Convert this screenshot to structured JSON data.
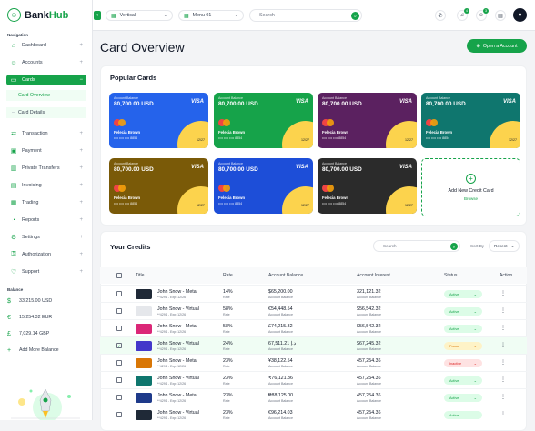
{
  "brand": {
    "name_a": "Bank",
    "name_b": "Hub"
  },
  "sidebar": {
    "navigation_label": "Navigation",
    "items": [
      {
        "label": "Dashboard",
        "icon": "home-icon"
      },
      {
        "label": "Accounts",
        "icon": "users-icon"
      },
      {
        "label": "Cards",
        "icon": "card-icon",
        "active": true
      },
      {
        "label": "Transaction",
        "icon": "transfer-icon"
      },
      {
        "label": "Payment",
        "icon": "wallet-icon"
      },
      {
        "label": "Private Transfers",
        "icon": "bars-icon"
      },
      {
        "label": "Invoicing",
        "icon": "document-icon"
      },
      {
        "label": "Trading",
        "icon": "chart-icon"
      },
      {
        "label": "Reports",
        "icon": "pie-icon"
      },
      {
        "label": "Settings",
        "icon": "gear-icon"
      },
      {
        "label": "Authorization",
        "icon": "key-icon"
      },
      {
        "label": "Support",
        "icon": "support-icon"
      }
    ],
    "sub_items": [
      {
        "label": "Card Overview",
        "active": true
      },
      {
        "label": "Card Details"
      }
    ],
    "balance_label": "Balance",
    "balances": [
      {
        "symbol": "$",
        "value": "33,215.00 USD"
      },
      {
        "symbol": "€",
        "value": "15,254.32 EUR"
      },
      {
        "symbol": "£",
        "value": "7,029.14 GBP"
      },
      {
        "symbol": "+",
        "value": "Add More Balance"
      }
    ]
  },
  "topbar": {
    "layout_select": "Vertical",
    "menu_select": "Menu 01",
    "search_placeholder": "Search",
    "notif_count": "4",
    "msg_count": "3"
  },
  "page": {
    "title": "Card Overview",
    "open_account": "Open a Account"
  },
  "popular": {
    "title": "Popular Cards",
    "more": "...",
    "cards": [
      {
        "label": "Account Balance",
        "balance": "80,700.00 USD",
        "brand": "VISA",
        "holder": "Felecia Brown",
        "number": "•••• •••• •••• 8854",
        "expiry": "12/27",
        "bg": "#2563eb"
      },
      {
        "label": "Account Balance",
        "balance": "80,700.00 USD",
        "brand": "VISA",
        "holder": "Felecia Brown",
        "number": "•••• •••• •••• 8854",
        "expiry": "12/27",
        "bg": "#16a34a"
      },
      {
        "label": "Account Balance",
        "balance": "80,700.00 USD",
        "brand": "VISA",
        "holder": "Felecia Brown",
        "number": "•••• •••• •••• 8854",
        "expiry": "12/27",
        "bg": "#5b2160"
      },
      {
        "label": "Account Balance",
        "balance": "80,700.00 USD",
        "brand": "VISA",
        "holder": "Felecia Brown",
        "number": "•••• •••• •••• 8854",
        "expiry": "12/27",
        "bg": "#0f766e"
      },
      {
        "label": "Account Balance",
        "balance": "80,700.00 USD",
        "brand": "VISA",
        "holder": "Felecia Brown",
        "number": "•••• •••• •••• 8854",
        "expiry": "12/27",
        "bg": "#7a5a08"
      },
      {
        "label": "Account Balance",
        "balance": "80,700.00 USD",
        "brand": "VISA",
        "holder": "Felecia Brown",
        "number": "•••• •••• •••• 8854",
        "expiry": "12/27",
        "bg": "#1d4ed8"
      },
      {
        "label": "Account Balance",
        "balance": "80,700.00 USD",
        "brand": "VISA",
        "holder": "Felecia Brown",
        "number": "•••• •••• •••• 8854",
        "expiry": "12/27",
        "bg": "#2b2b2b"
      }
    ],
    "add_card": {
      "title": "Add New Credit Card",
      "browse": "Browse"
    }
  },
  "credits": {
    "title": "Your Credits",
    "search_placeholder": "Search",
    "sort_label": "Sort By",
    "sort_value": "Recent",
    "columns": [
      "Title",
      "Rate",
      "Account Balance",
      "Account Interest",
      "Status",
      "Action"
    ],
    "rows": [
      {
        "name": "John Snow - Metal",
        "sub": "**4291 - Exp: 12/26",
        "rate": "14%",
        "rate_sub": "Rate",
        "balance": "$65,200.00",
        "balance_sub": "Account Balance",
        "interest": "321,121.32",
        "interest_sub": "Account Balance",
        "status": "Active",
        "thumb": "#1f2937",
        "checked": false
      },
      {
        "name": "John Snow - Virtual",
        "sub": "**4291 - Exp: 12/26",
        "rate": "58%",
        "rate_sub": "Rate",
        "balance": "€54,448.54",
        "balance_sub": "Account Balance",
        "interest": "$56,542.32",
        "interest_sub": "Account Balance",
        "status": "Active",
        "thumb": "#e5e7eb",
        "checked": false
      },
      {
        "name": "John Snow - Metal",
        "sub": "**4291 - Exp: 12/26",
        "rate": "58%",
        "rate_sub": "Rate",
        "balance": "£74,215.32",
        "balance_sub": "Account Balance",
        "interest": "$56,542.32",
        "interest_sub": "Account Balance",
        "status": "Active",
        "thumb": "#db2777",
        "checked": false
      },
      {
        "name": "John Snow - Virtual",
        "sub": "**4291 - Exp: 12/26",
        "rate": "24%",
        "rate_sub": "Rate",
        "balance": "67,511.21 د.إ",
        "balance_sub": "Account Balance",
        "interest": "$67,245.32",
        "interest_sub": "Account Balance",
        "status": "Pause",
        "thumb": "#4338ca",
        "checked": true
      },
      {
        "name": "John Snow - Metal",
        "sub": "**4291 - Exp: 12/26",
        "rate": "23%",
        "rate_sub": "Rate",
        "balance": "¥38,122.54",
        "balance_sub": "Account Balance",
        "interest": "457,254.36",
        "interest_sub": "Account Balance",
        "status": "Inactive",
        "thumb": "#d97706",
        "checked": false
      },
      {
        "name": "John Snow - Virtual",
        "sub": "**4291 - Exp: 12/26",
        "rate": "23%",
        "rate_sub": "Rate",
        "balance": "₹76,121.36",
        "balance_sub": "Account Balance",
        "interest": "457,254.36",
        "interest_sub": "Account Balance",
        "status": "Active",
        "thumb": "#0f766e",
        "checked": false
      },
      {
        "name": "John Snow - Metal",
        "sub": "**4291 - Exp: 12/26",
        "rate": "23%",
        "rate_sub": "Rate",
        "balance": "₱88,125.00",
        "balance_sub": "Account Balance",
        "interest": "457,254.36",
        "interest_sub": "Account Balance",
        "status": "Active",
        "thumb": "#1e3a8a",
        "checked": false
      },
      {
        "name": "John Snow - Virtual",
        "sub": "**4291 - Exp: 12/26",
        "rate": "23%",
        "rate_sub": "Rate",
        "balance": "€96,214.03",
        "balance_sub": "Account Balance",
        "interest": "457,254.36",
        "interest_sub": "Account Balance",
        "status": "Active",
        "thumb": "#1f2937",
        "checked": false
      }
    ]
  },
  "colors": {
    "accent": "#16a34a",
    "active_bg": "#dcfce7",
    "pause_bg": "#fef3c7",
    "inactive_bg": "#fee2e2"
  }
}
